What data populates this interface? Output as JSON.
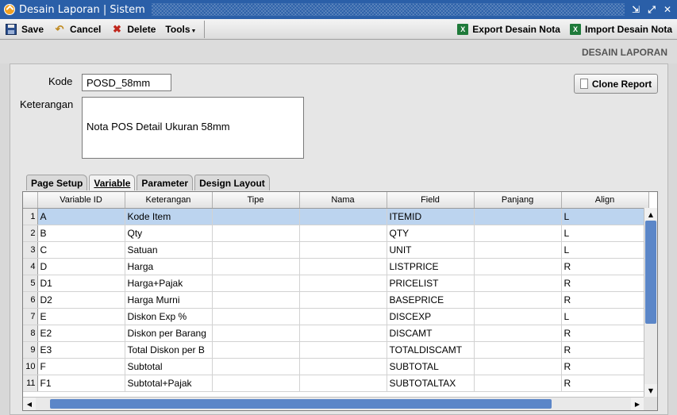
{
  "window": {
    "title": "Desain Laporan | Sistem"
  },
  "toolbar": {
    "save": "Save",
    "cancel": "Cancel",
    "delete": "Delete",
    "tools": "Tools",
    "export": "Export Desain Nota",
    "import": "Import Desain Nota"
  },
  "header": {
    "title": "DESAIN LAPORAN"
  },
  "form": {
    "kode_label": "Kode",
    "kode_value": "POSD_58mm",
    "keterangan_label": "Keterangan",
    "keterangan_value": "Nota POS Detail Ukuran 58mm",
    "clone_button": "Clone Report"
  },
  "tabs": [
    "Page Setup",
    "Variable",
    "Parameter",
    "Design Layout"
  ],
  "active_tab": "Variable",
  "grid": {
    "columns": [
      "Variable ID",
      "Keterangan",
      "Tipe",
      "Nama",
      "Field",
      "Panjang",
      "Align"
    ],
    "rows": [
      [
        "1",
        "A",
        "Kode Item",
        "",
        "",
        "ITEMID",
        "",
        "L"
      ],
      [
        "2",
        "B",
        "Qty",
        "",
        "",
        "QTY",
        "",
        "L"
      ],
      [
        "3",
        "C",
        "Satuan",
        "",
        "",
        "UNIT",
        "",
        "L"
      ],
      [
        "4",
        "D",
        "Harga",
        "",
        "",
        "LISTPRICE",
        "",
        "R"
      ],
      [
        "5",
        "D1",
        "Harga+Pajak",
        "",
        "",
        "PRICELIST",
        "",
        "R"
      ],
      [
        "6",
        "D2",
        "Harga Murni",
        "",
        "",
        "BASEPRICE",
        "",
        "R"
      ],
      [
        "7",
        "E",
        "Diskon Exp %",
        "",
        "",
        "DISCEXP",
        "",
        "L"
      ],
      [
        "8",
        "E2",
        "Diskon per Barang",
        "",
        "",
        "DISCAMT",
        "",
        "R"
      ],
      [
        "9",
        "E3",
        "Total Diskon per B",
        "",
        "",
        "TOTALDISCAMT",
        "",
        "R"
      ],
      [
        "10",
        "F",
        "Subtotal",
        "",
        "",
        "SUBTOTAL",
        "",
        "R"
      ],
      [
        "11",
        "F1",
        "Subtotal+Pajak",
        "",
        "",
        "SUBTOTALTAX",
        "",
        "R"
      ]
    ]
  },
  "colors": {
    "titlebar": "#2a5fa8",
    "selection": "#bcd4ef",
    "scroll_thumb": "#5b86c8"
  }
}
